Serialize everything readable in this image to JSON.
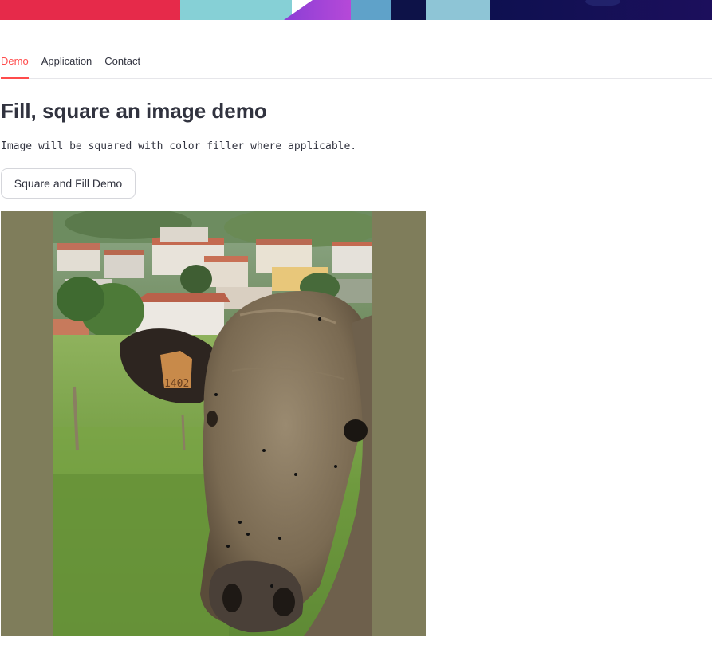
{
  "colors": {
    "accent": "#ff4b4b",
    "text": "#31333f",
    "fill_color": "#7f7d5b",
    "border": "#d5d6db"
  },
  "tabs": [
    {
      "label": "Demo",
      "active": true
    },
    {
      "label": "Application",
      "active": false
    },
    {
      "label": "Contact",
      "active": false
    }
  ],
  "main": {
    "title": "Fill, square an image demo",
    "description": "Image will be squared with color filler where applicable.",
    "button_label": "Square and Fill Demo",
    "image": {
      "subject": "cow",
      "ear_tag": "1402",
      "filler_color": "#7f7d5b"
    }
  }
}
